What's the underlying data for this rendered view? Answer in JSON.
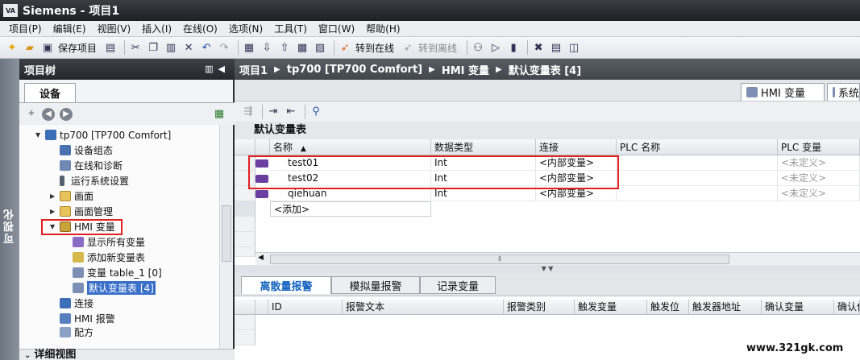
{
  "title_bar": {
    "logo": "VA",
    "text": "Siemens  -  项目1"
  },
  "menu": [
    "项目(P)",
    "编辑(E)",
    "视图(V)",
    "插入(I)",
    "在线(O)",
    "选项(N)",
    "工具(T)",
    "窗口(W)",
    "帮助(H)"
  ],
  "toolbar": {
    "save_label": "保存项目",
    "go_online": "转到在线",
    "go_offline": "转到离线"
  },
  "left_strip": {
    "label": "可视化"
  },
  "project_tree": {
    "header": "项目树",
    "tab": "设备",
    "items": [
      {
        "label": "tp700 [TP700 Comfort]",
        "icon": "device-icon"
      },
      {
        "label": "设备组态",
        "icon": "device-config-icon"
      },
      {
        "label": "在线和诊断",
        "icon": "diagnostics-icon"
      },
      {
        "label": "运行系统设置",
        "icon": "runtime-settings-icon"
      },
      {
        "label": "画面",
        "icon": "folder-icon"
      },
      {
        "label": "画面管理",
        "icon": "folder-icon"
      },
      {
        "label": "HMI 变量",
        "icon": "hmi-tags-icon"
      },
      {
        "label": "显示所有变量",
        "icon": "show-tags-icon"
      },
      {
        "label": "添加新变量表",
        "icon": "add-table-icon"
      },
      {
        "label": "变量 table_1 [0]",
        "icon": "tag-table-icon"
      },
      {
        "label": "默认变量表 [4]",
        "icon": "tag-table-icon"
      },
      {
        "label": "连接",
        "icon": "connections-icon"
      },
      {
        "label": "HMI 报警",
        "icon": "alarms-icon"
      },
      {
        "label": "配方",
        "icon": "recipes-icon"
      }
    ],
    "details_label": "详细视图"
  },
  "breadcrumb": [
    "项目1",
    "tp700 [TP700 Comfort]",
    "HMI 变量",
    "默认变量表 [4]"
  ],
  "right_tabs": [
    "HMI 变量",
    "系统"
  ],
  "table_title": "默认变量表",
  "columns": [
    "名称",
    "数据类型",
    "连接",
    "PLC 名称",
    "PLC 变量"
  ],
  "rows": [
    {
      "name": "test01",
      "type": "Int",
      "connection": "<内部变量>",
      "plc_name": "",
      "plc_tag": "<未定义>"
    },
    {
      "name": "test02",
      "type": "Int",
      "connection": "<内部变量>",
      "plc_name": "",
      "plc_tag": "<未定义>"
    },
    {
      "name": "qiehuan",
      "type": "Int",
      "connection": "<内部变量>",
      "plc_name": "",
      "plc_tag": "<未定义>"
    }
  ],
  "add_row": "<添加>",
  "bottom_tabs": [
    "离散量报警",
    "模拟量报警",
    "记录变量"
  ],
  "alarm_columns": [
    "ID",
    "报警文本",
    "报警类别",
    "触发变量",
    "触发位",
    "触发器地址",
    "确认变量",
    "确认位"
  ],
  "watermark": "www.321gk.com",
  "colors": {
    "highlight_box": "#e02020",
    "active_tab_text": "#1764c0",
    "selected_item": "#3a70c8"
  }
}
